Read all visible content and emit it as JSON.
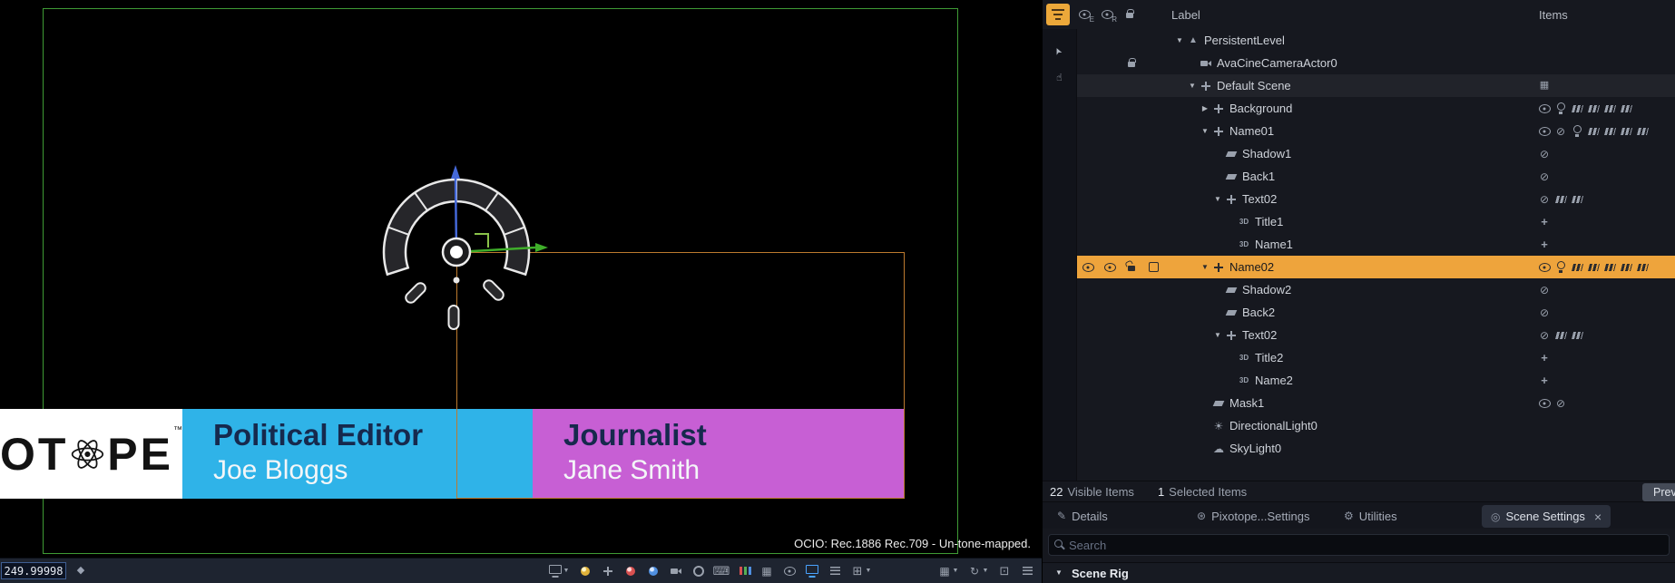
{
  "viewport": {
    "ocio_text": "OCIO: Rec.1886 Rec.709 - Un-tone-mapped.",
    "frame_value": "249.99998",
    "logo": {
      "left": "OT",
      "right": "PE",
      "mark": "™"
    },
    "lower_thirds": [
      {
        "title": "Political Editor",
        "name": "Joe Bloggs"
      },
      {
        "title": "Journalist",
        "name": "Jane Smith"
      }
    ],
    "colors": {
      "card1_bg": "#2fb3e8",
      "card2_bg": "#c75fd4",
      "frame_green": "#3f9b35",
      "selection_orange": "#bd7a2e",
      "axis_x_green": "#3fae2a",
      "axis_z_blue": "#4468d8"
    }
  },
  "toolbar": {
    "icons": [
      {
        "name": "view-mode-dropdown",
        "kind": "monitor",
        "caret": true
      },
      {
        "name": "lit-shading-toggle",
        "kind": "dot-yellow"
      },
      {
        "name": "transform-tool",
        "kind": "cross"
      },
      {
        "name": "show-flag-red",
        "kind": "dot-red"
      },
      {
        "name": "show-flag-blue",
        "kind": "dot-blue"
      },
      {
        "name": "camera-view-toggle",
        "kind": "camera"
      },
      {
        "name": "focus-target-toggle",
        "kind": "ring"
      },
      {
        "name": "game-input-toggle",
        "kind": "keyboard"
      },
      {
        "name": "rgb-channels-toggle",
        "kind": "rgb"
      },
      {
        "name": "checker-overlay-toggle",
        "kind": "grid"
      },
      {
        "name": "visibility-toggle",
        "kind": "eye"
      },
      {
        "name": "output-monitor-toggle",
        "kind": "monitor",
        "active": true
      },
      {
        "name": "stats-list-toggle",
        "kind": "lines"
      },
      {
        "name": "layers-dropdown",
        "kind": "layers",
        "caret": true
      },
      {
        "name": "gap",
        "kind": "gap"
      },
      {
        "name": "grid-snap-dropdown",
        "kind": "grid",
        "caret": true
      },
      {
        "name": "rotation-snap-dropdown",
        "kind": "rotate",
        "caret": true
      },
      {
        "name": "screen-frame-toggle",
        "kind": "frame"
      },
      {
        "name": "viewport-options",
        "kind": "lines"
      }
    ]
  },
  "outliner": {
    "header": {
      "label_col": "Label",
      "items_col": "Items",
      "tools": [
        {
          "type": "eye",
          "letter": "E"
        },
        {
          "type": "eye",
          "letter": "R"
        },
        {
          "type": "lock",
          "letter": ""
        }
      ]
    },
    "colors": {
      "selected_row": "#eea43c",
      "filter_button": "#eca83a"
    },
    "rows": [
      {
        "label": "PersistentLevel",
        "level": 0,
        "expander": "down",
        "icon": "level",
        "items": [],
        "gutter": []
      },
      {
        "label": "AvaCineCameraActor0",
        "level": 1,
        "expander": null,
        "icon": "camera",
        "items": [],
        "gutter": [
          null,
          null,
          "lock",
          null
        ]
      },
      {
        "label": "Default Scene",
        "level": 1,
        "expander": "down",
        "icon": "move",
        "highlighted": true,
        "items": [
          "pattern"
        ],
        "gutter": []
      },
      {
        "label": "Background",
        "level": 2,
        "expander": "right",
        "icon": "move",
        "items": [
          "eye",
          "bulb",
          "strip",
          "strip",
          "strip",
          "strip"
        ],
        "gutter": []
      },
      {
        "label": "Name01",
        "level": 2,
        "expander": "down",
        "icon": "move",
        "items": [
          "eye",
          "slash",
          "bulb",
          "strip",
          "strip",
          "strip",
          "strip"
        ],
        "gutter": []
      },
      {
        "label": "Shadow1",
        "level": 3,
        "expander": null,
        "icon": "plane",
        "items": [
          "slash"
        ],
        "gutter": []
      },
      {
        "label": "Back1",
        "level": 3,
        "expander": null,
        "icon": "plane",
        "items": [
          "slash"
        ],
        "gutter": []
      },
      {
        "label": "Text02",
        "level": 3,
        "expander": "down",
        "icon": "move",
        "items": [
          "slash",
          "strip",
          "strip"
        ],
        "gutter": []
      },
      {
        "label": "Title1",
        "level": 4,
        "expander": null,
        "icon": "text3d",
        "items": [
          "plus"
        ],
        "gutter": []
      },
      {
        "label": "Name1",
        "level": 4,
        "expander": null,
        "icon": "text3d",
        "items": [
          "plus"
        ],
        "gutter": []
      },
      {
        "label": "Name02",
        "level": 2,
        "expander": "down",
        "icon": "move",
        "selected": true,
        "items": [
          "eye",
          "bulb",
          "strip",
          "strip",
          "strip",
          "strip",
          "strip"
        ],
        "gutter": [
          "eye",
          "eye",
          "unlock",
          "checkbox"
        ]
      },
      {
        "label": "Shadow2",
        "level": 3,
        "expander": null,
        "icon": "plane",
        "items": [
          "slash"
        ],
        "gutter": []
      },
      {
        "label": "Back2",
        "level": 3,
        "expander": null,
        "icon": "plane",
        "items": [
          "slash"
        ],
        "gutter": []
      },
      {
        "label": "Text02",
        "level": 3,
        "expander": "down",
        "icon": "move",
        "items": [
          "slash",
          "strip",
          "strip"
        ],
        "gutter": []
      },
      {
        "label": "Title2",
        "level": 4,
        "expander": null,
        "icon": "text3d",
        "items": [
          "plus"
        ],
        "gutter": []
      },
      {
        "label": "Name2",
        "level": 4,
        "expander": null,
        "icon": "text3d",
        "items": [
          "plus"
        ],
        "gutter": []
      },
      {
        "label": "Mask1",
        "level": 2,
        "expander": null,
        "icon": "plane",
        "items": [
          "eye",
          "slash"
        ],
        "gutter": []
      },
      {
        "label": "DirectionalLight0",
        "level": 2,
        "expander": null,
        "icon": "sun",
        "items": [],
        "gutter": []
      },
      {
        "label": "SkyLight0",
        "level": 2,
        "expander": null,
        "icon": "sky",
        "items": [],
        "gutter": []
      }
    ],
    "status": {
      "visible_count": "22",
      "visible_label": "Visible Items",
      "selected_count": "1",
      "selected_label": "Selected Items",
      "preview_button": "Preview"
    }
  },
  "tabs": [
    {
      "label": "Details",
      "icon": "pencil"
    },
    {
      "label": "Pixotope...Settings",
      "icon": "atom"
    },
    {
      "label": "Utilities",
      "icon": "gear"
    },
    {
      "label": "Scene Settings",
      "icon": "target",
      "active": true,
      "closable": true,
      "close_glyph": "×"
    }
  ],
  "search": {
    "placeholder": "Search"
  },
  "scene_rig": {
    "label": "Scene Rig"
  }
}
